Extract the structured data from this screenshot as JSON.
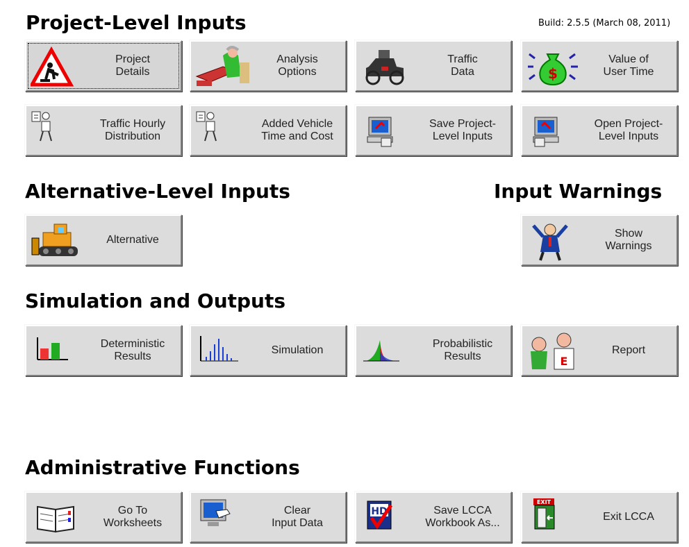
{
  "headings": {
    "project": "Project-Level Inputs",
    "alternative": "Alternative-Level Inputs",
    "warnings": "Input Warnings",
    "simulation": "Simulation and Outputs",
    "admin": "Administrative Functions"
  },
  "build": "Build: 2.5.5 (March 08, 2011)",
  "buttons": {
    "project_details": "Project\nDetails",
    "analysis_options": "Analysis\nOptions",
    "traffic_data": "Traffic\nData",
    "value_user_time": "Value of\nUser Time",
    "traffic_hourly": "Traffic Hourly\nDistribution",
    "added_vehicle": "Added Vehicle\nTime and Cost",
    "save_project": "Save Project-\nLevel Inputs",
    "open_project": "Open Project-\nLevel Inputs",
    "alternative": "Alternative",
    "show_warnings": "Show\nWarnings",
    "deterministic": "Deterministic\nResults",
    "simulation": "Simulation",
    "probabilistic": "Probabilistic\nResults",
    "report": "Report",
    "goto_worksheets": "Go To\nWorksheets",
    "clear_input": "Clear\nInput Data",
    "save_workbook": "Save LCCA\nWorkbook As...",
    "exit": "Exit LCCA"
  },
  "icons": {
    "project_details": "road-work-sign-icon",
    "analysis_options": "person-at-desk-icon",
    "traffic_data": "antique-car-icon",
    "value_user_time": "money-bag-icon",
    "traffic_hourly": "clipboard-person-icon",
    "added_vehicle": "clipboard-person-icon",
    "save_project": "computer-save-icon",
    "open_project": "computer-open-icon",
    "alternative": "bulldozer-icon",
    "show_warnings": "alarmed-man-icon",
    "deterministic": "bar-chart-icon",
    "simulation": "histogram-icon",
    "probabilistic": "distribution-curve-icon",
    "report": "report-characters-icon",
    "goto_worksheets": "open-book-icon",
    "clear_input": "monitor-hand-icon",
    "save_workbook": "hd-checkmark-icon",
    "exit": "exit-door-icon"
  },
  "colors": {
    "button_face": "#dcdcdc",
    "background": "#ffffff"
  }
}
